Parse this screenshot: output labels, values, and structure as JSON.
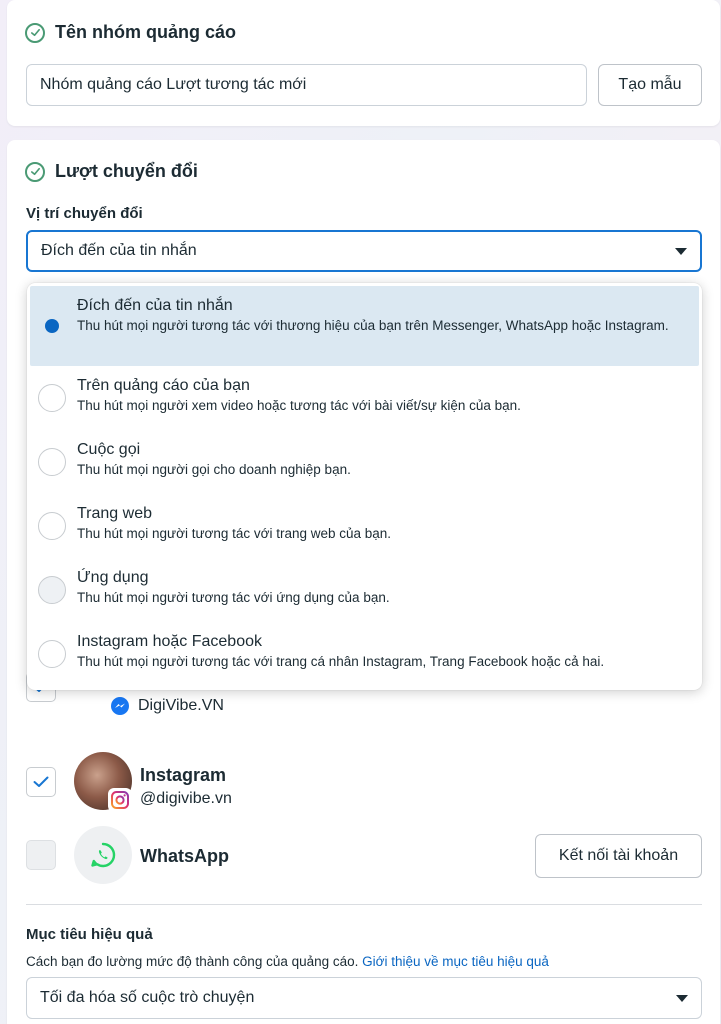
{
  "ad_group_section": {
    "title": "Tên nhóm quảng cáo",
    "name_value": "Nhóm quảng cáo Lượt tương tác mới",
    "template_button": "Tạo mẫu"
  },
  "conversion_section": {
    "title": "Lượt chuyển đổi",
    "location_label": "Vị trí chuyển đổi",
    "location_selected": "Đích đến của tin nhắn",
    "options": [
      {
        "title": "Đích đến của tin nhắn",
        "desc": "Thu hút mọi người tương tác với thương hiệu của bạn trên Messenger, WhatsApp hoặc Instagram.",
        "selected": true
      },
      {
        "title": "Trên quảng cáo của bạn",
        "desc": "Thu hút mọi người xem video hoặc tương tác với bài viết/sự kiện của bạn.",
        "selected": false
      },
      {
        "title": "Cuộc gọi",
        "desc": "Thu hút mọi người gọi cho doanh nghiệp bạn.",
        "selected": false
      },
      {
        "title": "Trang web",
        "desc": "Thu hút mọi người tương tác với trang web của bạn.",
        "selected": false
      },
      {
        "title": "Ứng dụng",
        "desc": "Thu hút mọi người tương tác với ứng dụng của bạn.",
        "selected": false
      },
      {
        "title": "Instagram hoặc Facebook",
        "desc": "Thu hút mọi người tương tác với trang cá nhân Instagram, Trang Facebook hoặc cả hai.",
        "selected": false
      }
    ]
  },
  "accounts": {
    "messenger_handle": "DigiVibe.VN",
    "instagram_name": "Instagram",
    "instagram_handle": "@digivibe.vn",
    "whatsapp_name": "WhatsApp",
    "connect_button": "Kết nối tài khoản"
  },
  "goal_section": {
    "label": "Mục tiêu hiệu quả",
    "hint": "Cách bạn đo lường mức độ thành công của quảng cáo.",
    "hint_link": "Giới thiệu về mục tiêu hiệu quả",
    "selected": "Tối đa hóa số cuộc trò chuyện"
  },
  "colors": {
    "accent": "#0a66c2",
    "check_green": "#4a9a74",
    "selected_bg": "#dbe8f2"
  }
}
